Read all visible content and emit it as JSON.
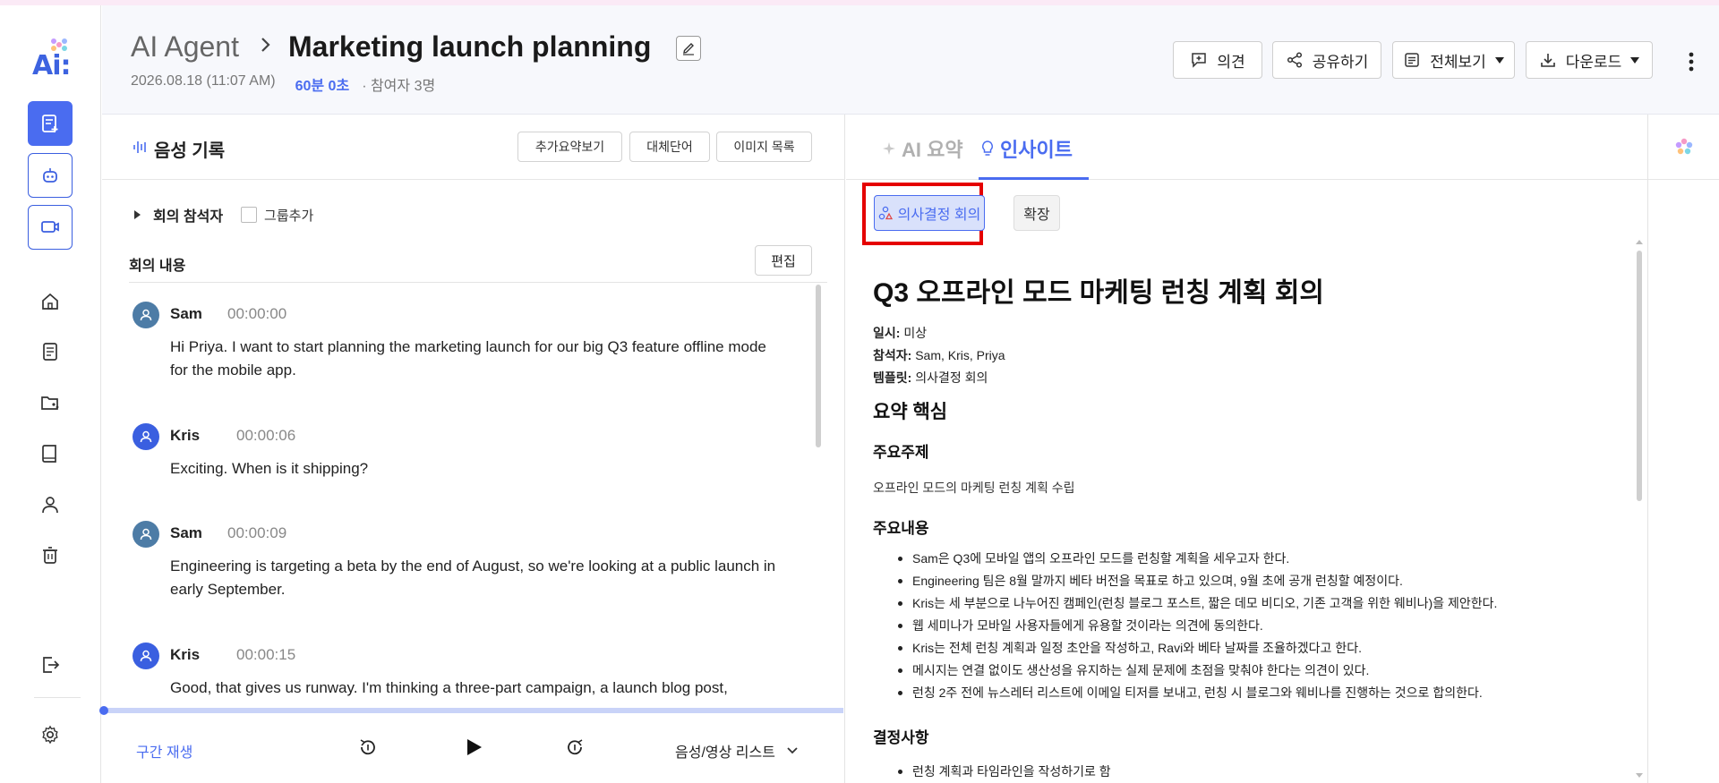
{
  "app": {
    "logo_text": "Ai:",
    "brand_color": "#4a6cf0",
    "rail_icons": [
      "note-add-icon",
      "bot-icon",
      "cast-icon",
      "home-icon",
      "document-icon",
      "shared-folder-icon",
      "book-icon",
      "person-icon",
      "trash-icon",
      "logout-icon",
      "gear-icon"
    ]
  },
  "header": {
    "root": "AI Agent",
    "title": "Marketing launch planning",
    "date": "2026.08.18 (11:07 AM)",
    "duration": "60분 0초",
    "participants": "· 참여자 3명",
    "buttons": {
      "opinion": "의견",
      "share": "공유하기",
      "view_all": "전체보기",
      "download": "다운로드"
    }
  },
  "voice": {
    "title": "음성 기록",
    "buttons": {
      "extra_summary": "추가요약보기",
      "replace_word": "대체단어",
      "image_list": "이미지 목록"
    },
    "participants_label": "회의 참석자",
    "group_add": "그룹추가",
    "content_label": "회의 내용",
    "edit": "편집",
    "utterances": [
      {
        "speaker": "Sam",
        "time": "00:00:00",
        "text": "Hi Priya. I want to start planning the marketing launch for our big Q3 feature offline mode for the mobile app.",
        "color": "#4d7ca6"
      },
      {
        "speaker": "Kris",
        "time": "00:00:06",
        "text": "Exciting. When is it shipping?",
        "color": "#3a5fe0"
      },
      {
        "speaker": "Sam",
        "time": "00:00:09",
        "text": "Engineering is targeting a beta by the end of August, so we're looking at a public launch in early September.",
        "color": "#4d7ca6"
      },
      {
        "speaker": "Kris",
        "time": "00:00:15",
        "text": "Good, that gives us runway.  I'm thinking a three-part campaign, a launch blog post,",
        "color": "#3a5fe0"
      }
    ],
    "player": {
      "section_play": "구간 재생",
      "media_list": "음성/영상 리스트",
      "progress_fraction": 0.0
    }
  },
  "insight": {
    "tabs": {
      "summary": "AI 요약",
      "insight": "인사이트"
    },
    "chips": {
      "decision": "의사결정 회의",
      "expand": "확장"
    },
    "doc": {
      "title": "Q3 오프라인 모드 마케팅 런칭 계획 회의",
      "date_label": "일시:",
      "date_value": "미상",
      "attendees_label": "참석자:",
      "attendees_value": "Sam, Kris, Priya",
      "template_label": "템플릿:",
      "template_value": "의사결정 회의",
      "summary_heading": "요약 핵심",
      "topic_heading": "주요주제",
      "topic_text": "오프라인 모드의 마케팅 런칭 계획 수립",
      "content_heading": "주요내용",
      "content_items": [
        "Sam은 Q3에 모바일 앱의 오프라인 모드를 런칭할 계획을 세우고자 한다.",
        "Engineering 팀은 8월 말까지 베타 버전을 목표로 하고 있으며, 9월 초에 공개 런칭할 예정이다.",
        "Kris는 세 부분으로 나누어진 캠페인(런칭 블로그 포스트, 짧은 데모 비디오, 기존 고객을 위한 웨비나)을 제안한다.",
        "웹 세미나가 모바일 사용자들에게 유용할 것이라는 의견에 동의한다.",
        "Kris는 전체 런칭 계획과 일정 초안을 작성하고, Ravi와 베타 날짜를 조율하겠다고 한다.",
        "메시지는 연결 없이도 생산성을 유지하는 실제 문제에 초점을 맞춰야 한다는 의견이 있다.",
        "런칭 2주 전에 뉴스레터 리스트에 이메일 티저를 보내고, 런칭 시 블로그와 웨비나를 진행하는 것으로 합의한다."
      ],
      "decision_heading": "결정사항",
      "decision_items": [
        "런칭 계획과 타임라인을 작성하기로 함"
      ]
    }
  }
}
